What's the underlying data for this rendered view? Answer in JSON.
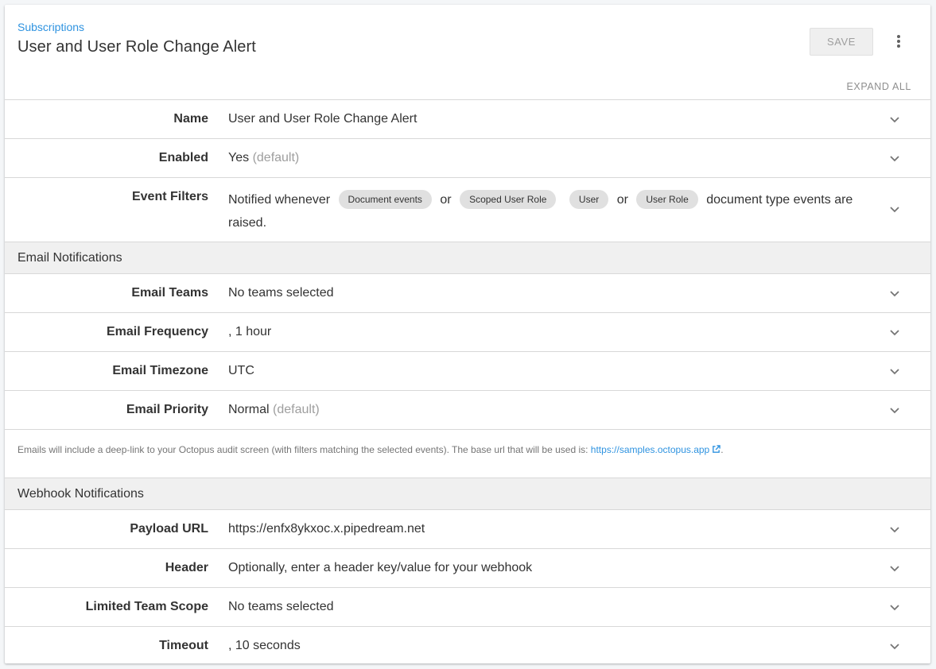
{
  "header": {
    "breadcrumb": "Subscriptions",
    "title": "User and User Role Change Alert",
    "save_label": "SAVE",
    "more_icon": "more-vert-icon",
    "expand_all": "EXPAND ALL"
  },
  "general": {
    "name": {
      "label": "Name",
      "value": "User and User Role Change Alert"
    },
    "enabled": {
      "label": "Enabled",
      "value": "Yes",
      "hint": "(default)"
    },
    "event_filters": {
      "label": "Event Filters",
      "prefix": "Notified whenever",
      "chip1": "Document events",
      "or1": "or",
      "chip2": "Scoped User Role",
      "chip3": "User",
      "or2": "or",
      "chip4": "User Role",
      "suffix": "document type events are raised."
    }
  },
  "email": {
    "section_title": "Email Notifications",
    "teams": {
      "label": "Email Teams",
      "value": "No teams selected"
    },
    "frequency": {
      "label": "Email Frequency",
      "value": ", 1 hour"
    },
    "timezone": {
      "label": "Email Timezone",
      "value": "UTC"
    },
    "priority": {
      "label": "Email Priority",
      "value": "Normal",
      "hint": "(default)"
    },
    "note_text": "Emails will include a deep-link to your Octopus audit screen (with filters matching the selected events). The base url that will be used is: ",
    "note_link": "https://samples.octopus.app",
    "note_end": "."
  },
  "webhook": {
    "section_title": "Webhook Notifications",
    "payload": {
      "label": "Payload URL",
      "value": "https://enfx8ykxoc.x.pipedream.net"
    },
    "header": {
      "label": "Header",
      "value": "Optionally, enter a header key/value for your webhook"
    },
    "team_scope": {
      "label": "Limited Team Scope",
      "value": "No teams selected"
    },
    "timeout": {
      "label": "Timeout",
      "value": ", 10 seconds"
    }
  },
  "colors": {
    "link": "#2f93e0",
    "muted": "#9e9e9e",
    "section_bg": "#f0f0f0"
  }
}
